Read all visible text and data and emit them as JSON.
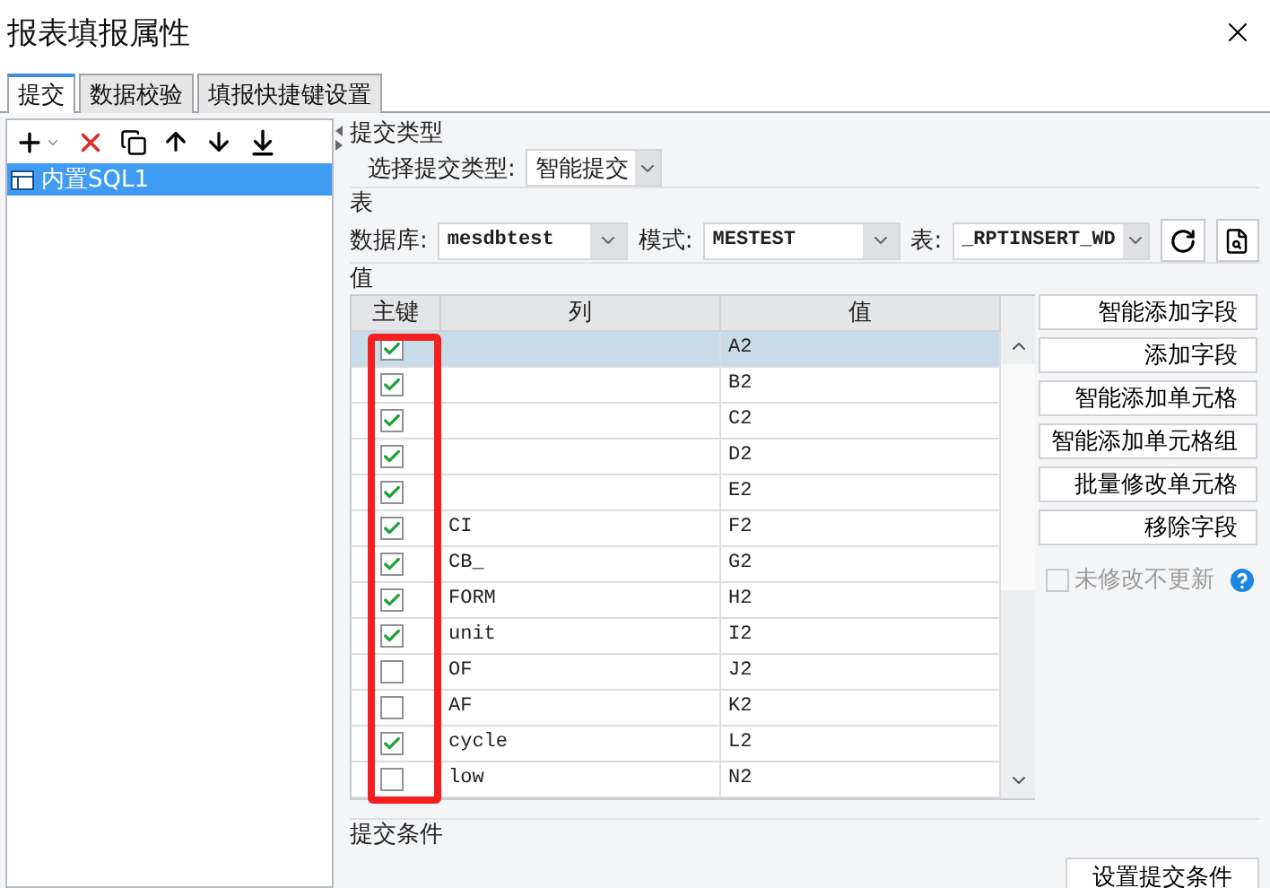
{
  "window": {
    "title": "报表填报属性"
  },
  "tabs": [
    {
      "label": "提交",
      "selected": true
    },
    {
      "label": "数据校验",
      "selected": false
    },
    {
      "label": "填报快捷键设置",
      "selected": false
    }
  ],
  "tree": {
    "items": [
      {
        "label": "内置SQL1",
        "selected": true
      }
    ]
  },
  "submit_type": {
    "heading": "提交类型",
    "label": "选择提交类型:",
    "value": "智能提交"
  },
  "table_section": {
    "heading": "表",
    "database": {
      "label": "数据库:",
      "value": "mesdbtest"
    },
    "schema": {
      "label": "模式:",
      "value": "MESTEST"
    },
    "table": {
      "label": "表:",
      "value": "_RPTINSERT_WD"
    }
  },
  "values": {
    "heading": "值",
    "columns": [
      "主键",
      "列",
      "值"
    ],
    "rows": [
      {
        "key": true,
        "value": "A2",
        "selected": true
      },
      {
        "key": true,
        "value": "B2",
        "selected": false
      },
      {
        "key": true,
        "value": "C2",
        "selected": false
      },
      {
        "key": true,
        "value": "D2",
        "selected": false
      },
      {
        "key": true,
        "value": "E2",
        "selected": false
      },
      {
        "key": true,
        "column": "CI",
        "value": "F2",
        "selected": false
      },
      {
        "key": true,
        "column": "CB_",
        "value": "G2",
        "selected": false
      },
      {
        "key": true,
        "column": "FORM",
        "value": "H2",
        "selected": false
      },
      {
        "key": true,
        "column": "unit",
        "value": "I2",
        "selected": false
      },
      {
        "key": false,
        "column": "OF",
        "value": "J2",
        "selected": false
      },
      {
        "key": false,
        "column": "AF",
        "value": "K2",
        "selected": false
      },
      {
        "key": true,
        "column": "cycle",
        "value": "L2",
        "selected": false
      },
      {
        "key": false,
        "column": "low",
        "value": "N2",
        "selected": false
      }
    ]
  },
  "buttons": [
    "智能添加字段",
    "添加字段",
    "智能添加单元格",
    "智能添加单元格组",
    "批量修改单元格",
    "移除字段"
  ],
  "unchanged_no_update": {
    "label": "未修改不更新",
    "checked": false,
    "disabled": true
  },
  "condition": {
    "heading": "提交条件",
    "button": "设置提交条件"
  }
}
